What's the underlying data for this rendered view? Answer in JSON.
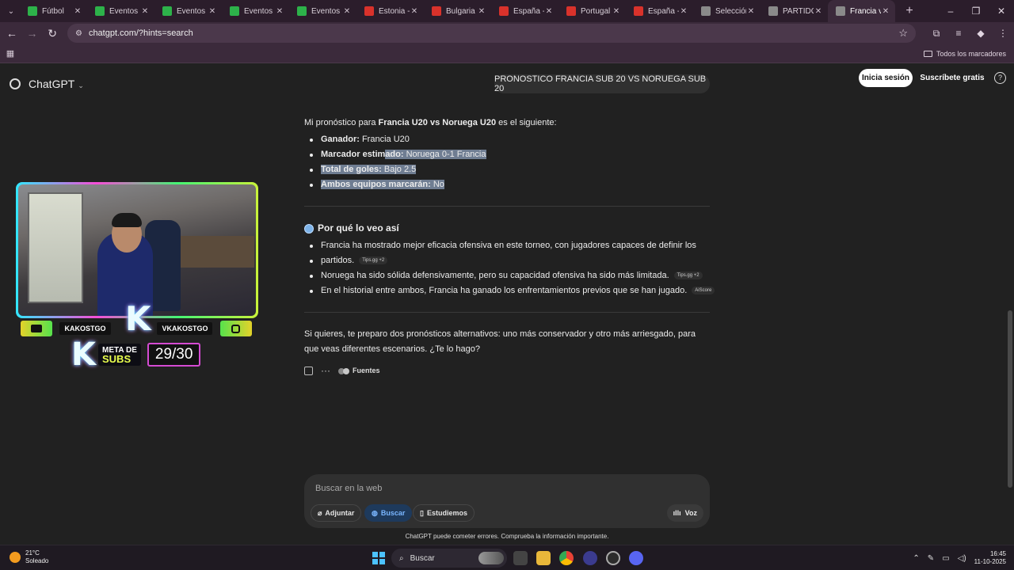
{
  "browser": {
    "tabs": [
      {
        "title": "Fútbol",
        "color": "#2db24a"
      },
      {
        "title": "Eventos -",
        "color": "#2db24a"
      },
      {
        "title": "Eventos -",
        "color": "#2db24a"
      },
      {
        "title": "Eventos -",
        "color": "#2db24a"
      },
      {
        "title": "Eventos -",
        "color": "#2db24a"
      },
      {
        "title": "Estonia -",
        "color": "#d9322b"
      },
      {
        "title": "Bulgaria -",
        "color": "#d9322b"
      },
      {
        "title": "España -",
        "color": "#d9322b"
      },
      {
        "title": "Portugal -",
        "color": "#d9322b"
      },
      {
        "title": "España -",
        "color": "#d9322b"
      },
      {
        "title": "Selección",
        "color": "#8a8a8a"
      },
      {
        "title": "PARTIDOS",
        "color": "#8a8a8a"
      },
      {
        "title": "Francia vs",
        "color": "#8a8a8a"
      }
    ],
    "url": "chatgpt.com/?hints=search",
    "all_bookmarks": "Todos los marcadores"
  },
  "chatgpt": {
    "brand": "ChatGPT",
    "user_prompt": "PRONOSTICO FRANCIA SUB 20 VS NORUEGA SUB 20",
    "login": "Inicia sesión",
    "signup": "Suscríbete gratis",
    "help": "?"
  },
  "answer": {
    "intro_pre": "Mi pronóstico para ",
    "intro_bold": "Francia U20 vs Noruega U20",
    "intro_post": " es el siguiente:",
    "predictions": [
      {
        "label": "Ganador:",
        "value": " Francia U20"
      },
      {
        "label": "Marcador estimado:",
        "value": " Noruega 0-1 Francia"
      },
      {
        "label": "Total de goles:",
        "value": " Bajo 2.5"
      },
      {
        "label": "Ambos equipos marcarán:",
        "value": " No"
      }
    ],
    "section_title": "Por qué lo veo así",
    "reasons": [
      {
        "text": "Francia ha mostrado mejor eficacia ofensiva en este torneo, con jugadores capaces de definir los",
        "text2": "partidos.",
        "source": "Tips.gg +2"
      },
      {
        "text": "Noruega ha sido sólida defensivamente, pero su capacidad ofensiva ha sido más limitada.",
        "source": "Tips.gg +2"
      },
      {
        "text": "En el historial entre ambos, Francia ha ganado los enfrentamientos previos que se han jugado.",
        "source": "AiScore"
      }
    ],
    "follow_up": "Si quieres, te preparo dos pronósticos alternativos: uno más conservador y otro más arriesgado, para que veas diferentes escenarios. ¿Te lo hago?",
    "sources_label": "Fuentes"
  },
  "composer": {
    "placeholder": "Buscar en la web",
    "attach": "Adjuntar",
    "search": "Buscar",
    "study": "Estudiemos",
    "voice": "Voz",
    "disclaimer": "ChatGPT puede cometer errores. Comprueba la información importante."
  },
  "overlay": {
    "left_name": "KAKOSTGO",
    "right_name": "VKAKOSTGO",
    "goal_line1": "META DE",
    "goal_line2": "SUBS",
    "goal_count": "29/30"
  },
  "taskbar": {
    "temp": "21°C",
    "weather": "Soleado",
    "search": "Buscar",
    "time": "16:45",
    "date": "11-10-2025"
  }
}
